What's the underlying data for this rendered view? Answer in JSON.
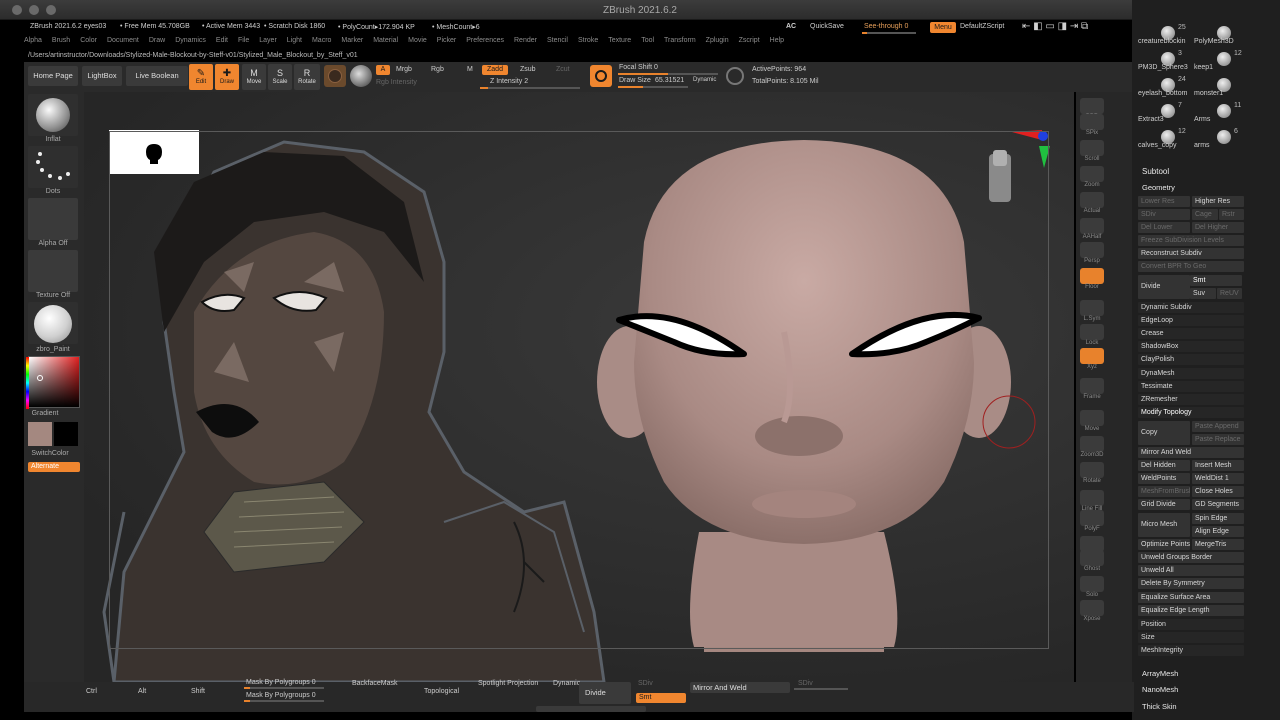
{
  "app": {
    "title": "ZBrush 2021.6.2"
  },
  "infobar": {
    "version": "ZBrush 2021.6.2 eyes03",
    "free_mem": "• Free Mem 45.708GB",
    "active_mem": "• Active Mem 3443",
    "scratch_disk": "• Scratch Disk 1860",
    "poly_count": "• PolyCount▸172.904 KP",
    "mesh_count": "• MeshCount▸6",
    "ac": "AC",
    "quicksave": "QuickSave",
    "seethrough": "See-through  0",
    "menu": "Menu",
    "default_zscript": "DefaultZScript"
  },
  "menubar": [
    "Alpha",
    "Brush",
    "Color",
    "Document",
    "Draw",
    "Dynamics",
    "Edit",
    "File",
    "Layer",
    "Light",
    "Macro",
    "Marker",
    "Material",
    "Movie",
    "Picker",
    "Preferences",
    "Render",
    "Stencil",
    "Stroke",
    "Texture",
    "Tool",
    "Transform",
    "Zplugin",
    "Zscript",
    "Help"
  ],
  "path": "/Users/artinstructor/Downloads/Stylized-Male-Blockout-by-Steff-v01/Stylized_Male_Blockout_by_Steff_v01",
  "shelf": {
    "home_page": "Home Page",
    "lightbox": "LightBox",
    "live_boolean": "Live Boolean",
    "edit": "Edit",
    "draw": "Draw",
    "move": "Move",
    "scale": "Scale",
    "rotate": "Rotate",
    "a": "A",
    "mrgb": "Mrgb",
    "rgb": "Rgb",
    "m": "M",
    "rgb_intensity": "Rgb Intensity",
    "zadd": "Zadd",
    "zsub": "Zsub",
    "zcut": "Zcut",
    "z_intensity": "Z Intensity 2",
    "focal_shift": "Focal Shift 0",
    "draw_size_label": "Draw Size",
    "draw_size_value": "65.31521",
    "dynamic": "Dynamic",
    "active_points": "ActivePoints: 964",
    "total_points": "TotalPoints: 8.105 Mil"
  },
  "leftbar": {
    "brush": "Inflat",
    "stroke": "Dots",
    "alpha": "Alpha Off",
    "texture": "Texture Off",
    "material": "zbro_Paint",
    "gradient": "Gradient",
    "switchcolor": "SwitchColor",
    "alternate": "Alternate"
  },
  "rightnav": [
    "BPR",
    "SPix",
    "Scroll",
    "Zoom",
    "Actual",
    "AAHalf",
    "Persp",
    "Floor",
    "L.Sym",
    "Lock",
    "Xyz",
    "Frame",
    "Move",
    "Zoom3D",
    "Rotate",
    "Line Fill",
    "PolyF",
    "Transp",
    "Ghost",
    "Solo",
    "Xpose"
  ],
  "tray": {
    "tools": [
      {
        "name": "creatureblockin",
        "count": "25"
      },
      {
        "name": "PolyMesh3D",
        "count": ""
      },
      {
        "name": "PM3D_Sphere3",
        "count": "3"
      },
      {
        "name": "keep1",
        "count": "12"
      },
      {
        "name": "eyelash_bottom",
        "count": "24"
      },
      {
        "name": "monster1",
        "count": ""
      },
      {
        "name": "Extract3",
        "count": "7"
      },
      {
        "name": "Arms",
        "count": "11"
      },
      {
        "name": "calves_copy",
        "count": "12"
      },
      {
        "name": "arms",
        "count": "6"
      }
    ],
    "subtool": "Subtool",
    "geometry": "Geometry",
    "lower_res": "Lower Res",
    "higher_res": "Higher Res",
    "sdiv": "SDiv",
    "cage": "Cage",
    "rstr": "Rstr",
    "del_lower": "Del Lower",
    "del_higher": "Del Higher",
    "freeze_subdiv": "Freeze SubDivision Levels",
    "reconstruct": "Reconstruct Subdiv",
    "convert_bpr": "Convert BPR To Geo",
    "divide": "Divide",
    "smt": "Smt",
    "suv": "Suv",
    "reuv": "ReUV",
    "dynamic_subdiv": "Dynamic Subdiv",
    "edgeloop": "EdgeLoop",
    "crease": "Crease",
    "shadowbox": "ShadowBox",
    "claypolish": "ClayPolish",
    "dynamesh": "DynaMesh",
    "tessimate": "Tessimate",
    "zremesher": "ZRemesher",
    "modify_topology": "Modify Topology",
    "copy": "Copy",
    "paste_append": "Paste Append",
    "paste_replace": "Paste Replace",
    "mirror_weld": "Mirror And Weld",
    "del_hidden": "Del Hidden",
    "insert_mesh": "Insert Mesh",
    "weldpoints": "WeldPoints",
    "welddist": "WeldDist 1",
    "meshfrombrush": "MeshFromBrush",
    "close_holes": "Close Holes",
    "grid_divide": "Grid Divide",
    "gd_segments": "GD Segments",
    "micro_mesh": "Micro Mesh",
    "spin_edge": "Spin Edge",
    "align_edge": "Align Edge",
    "optimize_points": "Optimize Points",
    "mergetris": "MergeTris",
    "unweld_groups": "Unweld Groups Border",
    "unweld_all": "Unweld All",
    "delete_symmetry": "Delete By Symmetry",
    "equalize_area": "Equalize Surface Area",
    "equalize_edge": "Equalize Edge Length",
    "position": "Position",
    "size": "Size",
    "meshintegrity": "MeshIntegrity",
    "arraymesh": "ArrayMesh",
    "nanomesh": "NanoMesh",
    "thick_skin": "Thick Skin"
  },
  "bottombar": {
    "ctrl": "Ctrl",
    "alt": "Alt",
    "shift": "Shift",
    "mask_polygroups_1": "Mask By Polygroups 0",
    "mask_polygroups_2": "Mask By Polygroups 0",
    "backfacemask": "BackfaceMask",
    "topological": "Topological",
    "spotlight": "Spotlight Projection",
    "dynamic": "Dynamic",
    "divide": "Divide",
    "sdiv": "SDiv",
    "smt": "Smt",
    "mirror_weld": "Mirror And Weld",
    "sdiv2": "SDiv"
  }
}
